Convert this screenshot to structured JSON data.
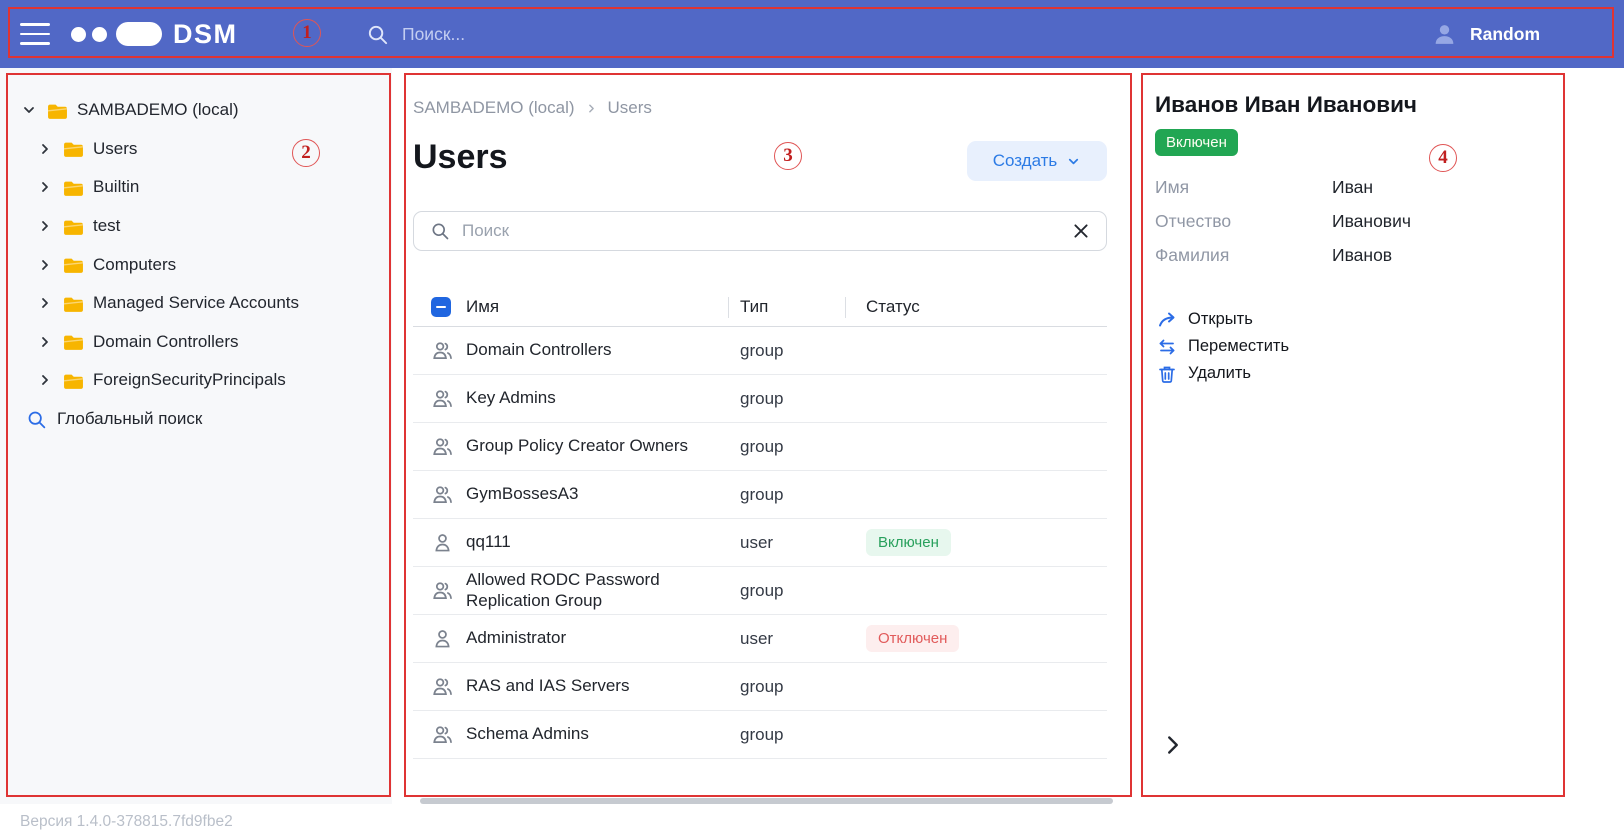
{
  "header": {
    "logo_text": "DSM",
    "search_placeholder": "Поиск...",
    "user_name": "Random"
  },
  "sidebar": {
    "root": {
      "label": "SAMBADEMO (local)"
    },
    "items": [
      {
        "label": "Users"
      },
      {
        "label": "Builtin"
      },
      {
        "label": "test"
      },
      {
        "label": "Computers"
      },
      {
        "label": "Managed Service Accounts"
      },
      {
        "label": "Domain Controllers"
      },
      {
        "label": "ForeignSecurityPrincipals"
      }
    ],
    "global_search_label": "Глобальный поиск",
    "version": "Версия 1.4.0-378815.7fd9fbe2"
  },
  "main": {
    "breadcrumb": {
      "root": "SAMBADEMO (local)",
      "current": "Users"
    },
    "title": "Users",
    "create_button_label": "Создать",
    "search_placeholder": "Поиск",
    "table": {
      "columns": {
        "name": "Имя",
        "type": "Тип",
        "status": "Статус"
      },
      "rows": [
        {
          "name": "Domain Controllers",
          "type": "group",
          "status": "",
          "status_kind": "none",
          "icon": "group"
        },
        {
          "name": "Key Admins",
          "type": "group",
          "status": "",
          "status_kind": "none",
          "icon": "group"
        },
        {
          "name": "Group Policy Creator Owners",
          "type": "group",
          "status": "",
          "status_kind": "none",
          "icon": "group"
        },
        {
          "name": "GymBossesA3",
          "type": "group",
          "status": "",
          "status_kind": "none",
          "icon": "group"
        },
        {
          "name": "qq111",
          "type": "user",
          "status": "Включен",
          "status_kind": "enabled",
          "icon": "user"
        },
        {
          "name": "Allowed RODC Password Replication Group",
          "type": "group",
          "status": "",
          "status_kind": "none",
          "icon": "group"
        },
        {
          "name": "Administrator",
          "type": "user",
          "status": "Отключен",
          "status_kind": "disabled",
          "icon": "user"
        },
        {
          "name": "RAS and IAS Servers",
          "type": "group",
          "status": "",
          "status_kind": "none",
          "icon": "group"
        },
        {
          "name": "Schema Admins",
          "type": "group",
          "status": "",
          "status_kind": "none",
          "icon": "group"
        }
      ]
    }
  },
  "details": {
    "title": "Иванов Иван Иванович",
    "status_badge": "Включен",
    "fields": [
      {
        "label": "Имя",
        "value": "Иван"
      },
      {
        "label": "Отчество",
        "value": "Иванович"
      },
      {
        "label": "Фамилия",
        "value": "Иванов"
      }
    ],
    "actions": [
      {
        "label": "Открыть",
        "kind": "open"
      },
      {
        "label": "Переместить",
        "kind": "move"
      },
      {
        "label": "Удалить",
        "kind": "delete"
      }
    ]
  },
  "annotations": {
    "n1": "1",
    "n2": "2",
    "n3": "3",
    "n4": "4"
  },
  "colors": {
    "header_blue": "#5168c6",
    "accent_blue": "#2c7be5",
    "enabled_green": "#21a653",
    "disabled_red": "#e15b5b",
    "folder_yellow": "#f7b500",
    "annotation_red": "#df3434"
  }
}
